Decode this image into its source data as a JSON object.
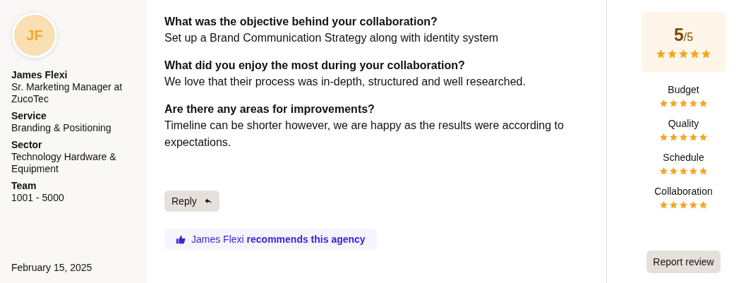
{
  "reviewer": {
    "initials": "JF",
    "name": "James Flexi",
    "role": "Sr. Marketing Manager at ZucoTec",
    "details": [
      {
        "label": "Service",
        "value": "Branding & Positioning"
      },
      {
        "label": "Sector",
        "value": "Technology Hardware & Equipment"
      },
      {
        "label": "Team",
        "value": "1001 - 5000"
      }
    ],
    "date": "February 15, 2025"
  },
  "answers": [
    {
      "question": "What was the objective behind your collaboration?",
      "answer": "Set up a Brand Communication Strategy along with identity system"
    },
    {
      "question": "What did you enjoy the most during your collaboration?",
      "answer": "We love that their process was in-depth, structured and well researched."
    },
    {
      "question": "Are there any areas for improvements?",
      "answer": "Timeline can be shorter however, we are happy as the results were according to expectations."
    }
  ],
  "reply_button": "Reply",
  "recommendation": "James Flexi **recommends this agency**",
  "overall": {
    "score": "5",
    "out_of": "/5",
    "stars": 5
  },
  "ratings": [
    {
      "label": "Budget",
      "stars": 5
    },
    {
      "label": "Quality",
      "stars": 5
    },
    {
      "label": "Schedule",
      "stars": 5
    },
    {
      "label": "Collaboration",
      "stars": 5
    }
  ],
  "report_button": "Report review"
}
